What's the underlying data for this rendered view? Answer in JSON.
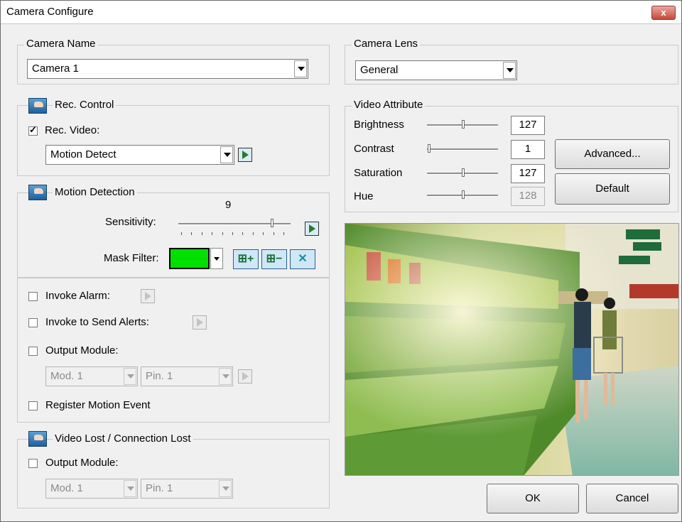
{
  "window": {
    "title": "Camera Configure",
    "close_label": "x"
  },
  "camera_name": {
    "legend": "Camera Name",
    "value": "Camera 1"
  },
  "camera_lens": {
    "legend": "Camera Lens",
    "value": "General"
  },
  "rec_control": {
    "legend": "Rec. Control",
    "rec_video_label": "Rec. Video:",
    "rec_video_checked": true,
    "mode_value": "Motion Detect"
  },
  "motion_detection": {
    "legend": "Motion Detection",
    "sensitivity_value": "9",
    "sensitivity_label": "Sensitivity:",
    "sensitivity_level": 9,
    "sensitivity_max": 10,
    "mask_filter_label": "Mask Filter:",
    "mask_color": "#00e000",
    "mask_add_label": "⊞+",
    "mask_remove_label": "⊞−",
    "mask_clear_label": "✕"
  },
  "alarms": {
    "invoke_alarm_label": "Invoke Alarm:",
    "invoke_alerts_label": "Invoke to Send Alerts:",
    "output_module_label": "Output Module:",
    "mod_value": "Mod. 1",
    "pin_value": "Pin. 1",
    "register_motion_label": "Register Motion Event"
  },
  "video_lost": {
    "legend": "Video Lost / Connection Lost",
    "output_module_label": "Output Module:",
    "mod_value": "Mod. 1",
    "pin_value": "Pin. 1"
  },
  "video_attribute": {
    "legend": "Video Attribute",
    "items": [
      {
        "label": "Brightness",
        "value": "127",
        "enabled": true
      },
      {
        "label": "Contrast",
        "value": "1",
        "enabled": true
      },
      {
        "label": "Saturation",
        "value": "127",
        "enabled": true
      },
      {
        "label": "Hue",
        "value": "128",
        "enabled": false
      }
    ],
    "advanced_label": "Advanced...",
    "default_label": "Default"
  },
  "buttons": {
    "ok_label": "OK",
    "cancel_label": "Cancel"
  }
}
